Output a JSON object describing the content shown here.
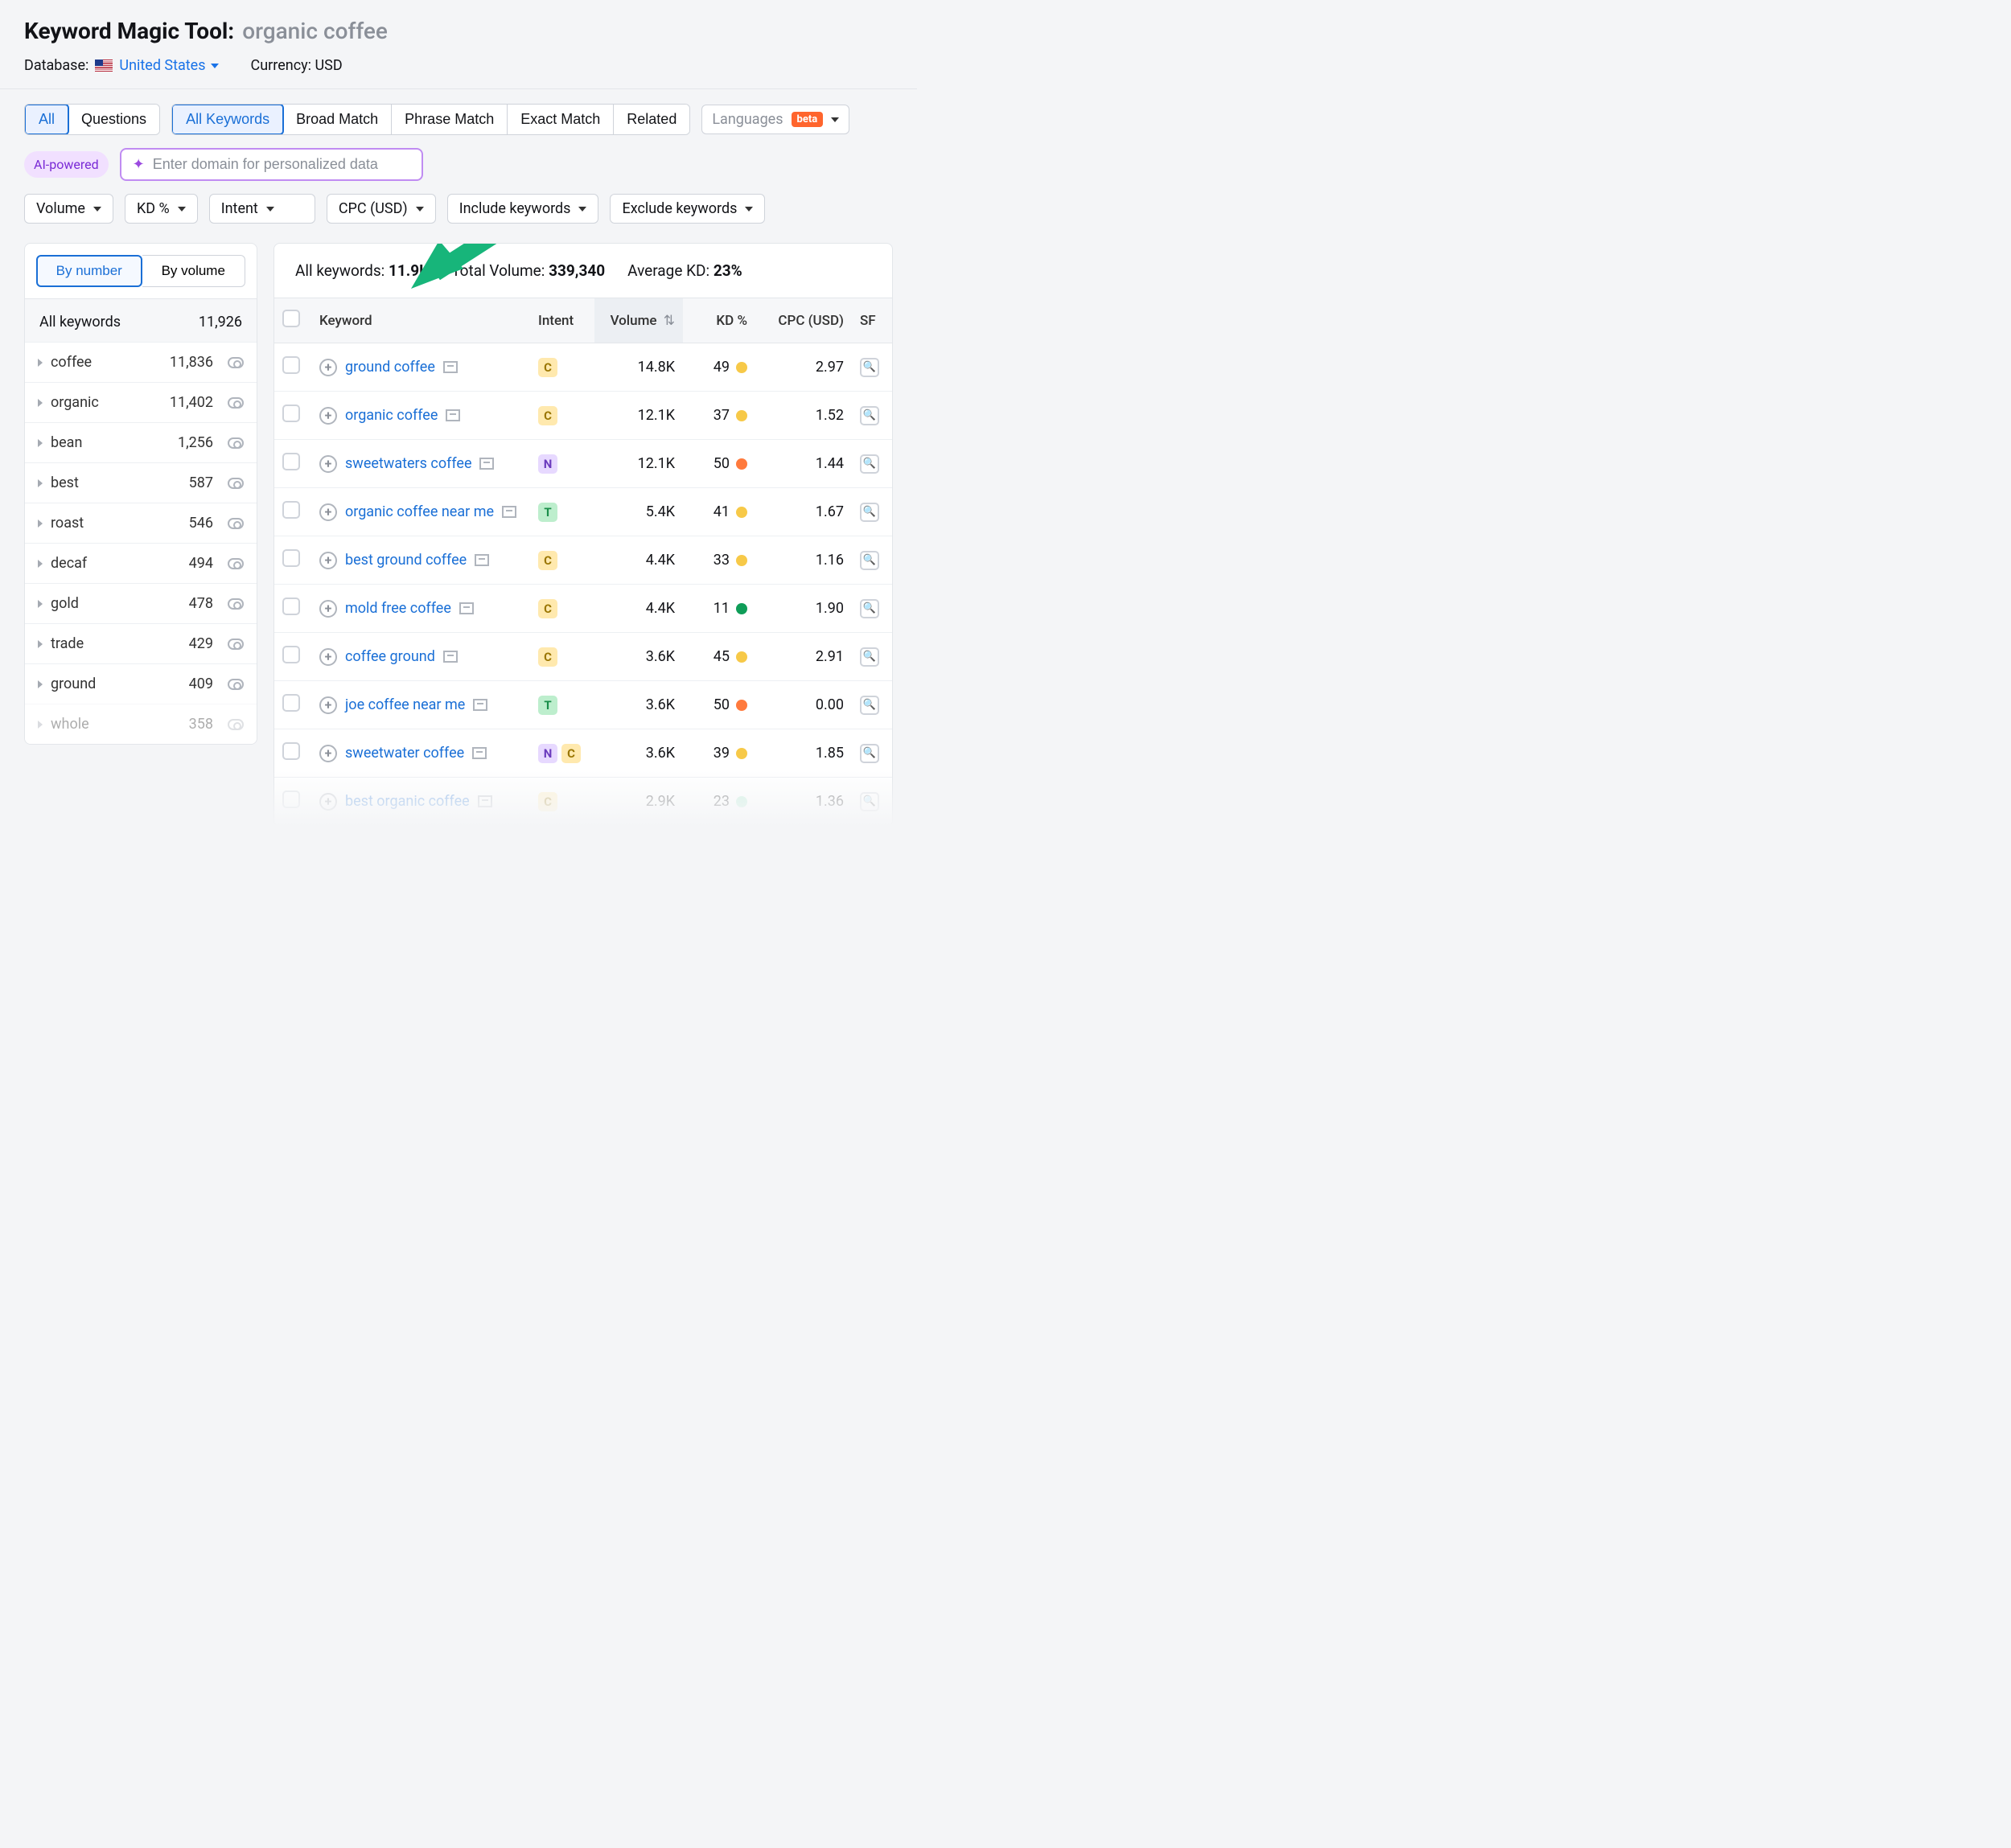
{
  "header": {
    "tool_name": "Keyword Magic Tool:",
    "query": "organic coffee",
    "database_label": "Database:",
    "database_value": "United States",
    "currency_label": "Currency:",
    "currency_value": "USD"
  },
  "tabs_primary": {
    "all": "All",
    "questions": "Questions"
  },
  "tabs_match": {
    "all_keywords": "All Keywords",
    "broad": "Broad Match",
    "phrase": "Phrase Match",
    "exact": "Exact Match",
    "related": "Related"
  },
  "languages": {
    "label": "Languages",
    "badge": "beta"
  },
  "ai_row": {
    "badge": "AI-powered",
    "placeholder": "Enter domain for personalized data"
  },
  "filters": {
    "volume": "Volume",
    "kd": "KD %",
    "intent": "Intent",
    "cpc": "CPC (USD)",
    "include": "Include keywords",
    "exclude": "Exclude keywords"
  },
  "sidebar": {
    "tab_number": "By number",
    "tab_volume": "By volume",
    "all_label": "All keywords",
    "all_count": "11,926",
    "categories": [
      {
        "name": "coffee",
        "count": "11,836"
      },
      {
        "name": "organic",
        "count": "11,402"
      },
      {
        "name": "bean",
        "count": "1,256"
      },
      {
        "name": "best",
        "count": "587"
      },
      {
        "name": "roast",
        "count": "546"
      },
      {
        "name": "decaf",
        "count": "494"
      },
      {
        "name": "gold",
        "count": "478"
      },
      {
        "name": "trade",
        "count": "429"
      },
      {
        "name": "ground",
        "count": "409"
      },
      {
        "name": "whole",
        "count": "358"
      }
    ]
  },
  "summary": {
    "all_kw_label": "All keywords:",
    "all_kw_value": "11.9K",
    "vol_label": "Total Volume:",
    "vol_value": "339,340",
    "kd_label": "Average KD:",
    "kd_value": "23%"
  },
  "columns": {
    "keyword": "Keyword",
    "intent": "Intent",
    "volume": "Volume",
    "kd": "KD %",
    "cpc": "CPC (USD)",
    "sf": "SF"
  },
  "rows": [
    {
      "keyword": "ground coffee",
      "intents": [
        "C"
      ],
      "volume": "14.8K",
      "kd": "49",
      "kd_color": "yellow",
      "cpc": "2.97"
    },
    {
      "keyword": "organic coffee",
      "intents": [
        "C"
      ],
      "volume": "12.1K",
      "kd": "37",
      "kd_color": "yellow",
      "cpc": "1.52"
    },
    {
      "keyword": "sweetwaters coffee",
      "intents": [
        "N"
      ],
      "volume": "12.1K",
      "kd": "50",
      "kd_color": "orange",
      "cpc": "1.44"
    },
    {
      "keyword": "organic coffee near me",
      "intents": [
        "T"
      ],
      "volume": "5.4K",
      "kd": "41",
      "kd_color": "yellow",
      "cpc": "1.67"
    },
    {
      "keyword": "best ground coffee",
      "intents": [
        "C"
      ],
      "volume": "4.4K",
      "kd": "33",
      "kd_color": "yellow",
      "cpc": "1.16"
    },
    {
      "keyword": "mold free coffee",
      "intents": [
        "C"
      ],
      "volume": "4.4K",
      "kd": "11",
      "kd_color": "green",
      "cpc": "1.90"
    },
    {
      "keyword": "coffee ground",
      "intents": [
        "C"
      ],
      "volume": "3.6K",
      "kd": "45",
      "kd_color": "yellow",
      "cpc": "2.91"
    },
    {
      "keyword": "joe coffee near me",
      "intents": [
        "T"
      ],
      "volume": "3.6K",
      "kd": "50",
      "kd_color": "orange",
      "cpc": "0.00"
    },
    {
      "keyword": "sweetwater coffee",
      "intents": [
        "N",
        "C"
      ],
      "volume": "3.6K",
      "kd": "39",
      "kd_color": "yellow",
      "cpc": "1.85"
    },
    {
      "keyword": "best organic coffee",
      "intents": [
        "C"
      ],
      "volume": "2.9K",
      "kd": "23",
      "kd_color": "mint",
      "cpc": "1.36"
    }
  ]
}
